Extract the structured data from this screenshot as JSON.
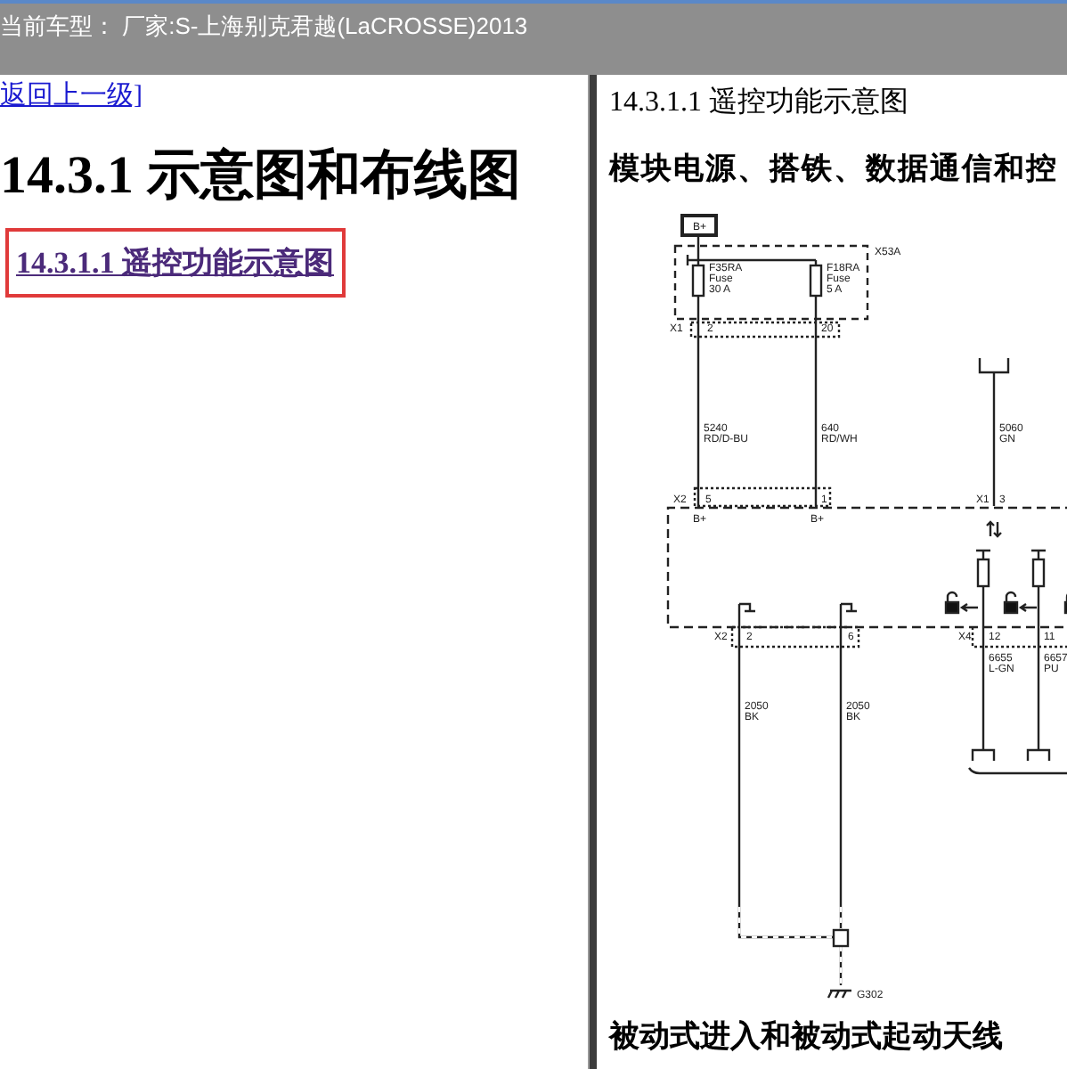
{
  "title_bar": {
    "text": "当前车型： 厂家:S-上海别克君越(LaCROSSE)2013"
  },
  "left_pane": {
    "back_link": "返回上一级]",
    "heading": "14.3.1 示意图和布线图",
    "toc_links": [
      {
        "label": "14.3.1.1 遥控功能示意图",
        "selected": true
      }
    ]
  },
  "right_pane": {
    "heading": "14.3.1.1 遥控功能示意图",
    "section_title": "模块电源、搭铁、数据通信和控",
    "diagram": {
      "labels": [
        "B+",
        "X53A",
        "F35RA",
        "Fuse",
        "30 A",
        "F18RA",
        "Fuse",
        "5 A",
        "X1",
        "2",
        "20",
        "5240",
        "RD/D-BU",
        "640",
        "RD/WH",
        "5060",
        "GN",
        "X2",
        "5",
        "1",
        "X1",
        "3",
        "B+",
        "B+",
        "X2",
        "2",
        "6",
        "X4",
        "12",
        "11",
        "6655",
        "L-GN",
        "6657",
        "PU",
        "2050",
        "BK",
        "2050",
        "BK",
        "G302"
      ]
    },
    "next_section_title": "被动式进入和被动式起动天线"
  }
}
